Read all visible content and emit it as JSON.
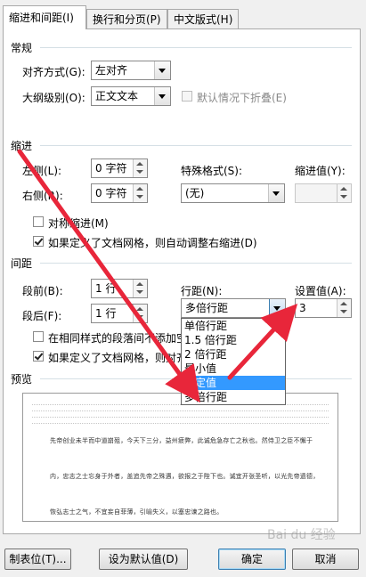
{
  "tabs": [
    {
      "label": "缩进和间距(I)"
    },
    {
      "label": "换行和分页(P)"
    },
    {
      "label": "中文版式(H)"
    }
  ],
  "general": {
    "title": "常规",
    "alignment_label": "对齐方式(G):",
    "alignment_value": "左对齐",
    "outline_label": "大纲级别(O):",
    "outline_value": "正文文本",
    "collapse_label": "默认情况下折叠(E)"
  },
  "indent": {
    "title": "缩进",
    "left_label": "左侧(L):",
    "left_value": "0 字符",
    "right_label": "右侧(R):",
    "right_value": "0 字符",
    "special_label": "特殊格式(S):",
    "special_value": "(无)",
    "indent_by_label": "缩进值(Y):",
    "indent_by_value": "",
    "mirror_label": "对称缩进(M)",
    "grid_adjust_label": "如果定义了文档网格，则自动调整右缩进(D)"
  },
  "spacing": {
    "title": "间距",
    "before_label": "段前(B):",
    "before_value": "1 行",
    "after_label": "段后(F):",
    "after_value": "1 行",
    "line_spacing_label": "行距(N):",
    "line_spacing_value": "多倍行距",
    "set_value_label": "设置值(A):",
    "set_value": "3",
    "no_space_label": "在相同样式的段落间不添加空格",
    "snap_grid_label": "如果定义了文档网格，则对齐到"
  },
  "line_spacing_options": [
    "单倍行距",
    "1.5 倍行距",
    "2 倍行距",
    "最小值",
    "固定值",
    "多倍行距"
  ],
  "line_spacing_selected_index": 4,
  "preview": {
    "title": "预览",
    "lines": [
      "先帝创业未半而中道崩殂，今天下三分，益州疲弊，此诚危急存亡之秋也。然侍卫之臣不懈于",
      "内，忠志之士忘身于外者，盖追先帝之殊遇，欲报之于陛下也。诚宜开张圣听，以光先帝遗德，",
      "恢弘志士之气，不宜妄自菲薄，引喻失义，以塞忠谏之路也。"
    ]
  },
  "buttons": {
    "tabs": "制表位(T)...",
    "set_default": "设为默认值(D)",
    "ok": "确定",
    "cancel": "取消"
  },
  "watermark": "Bai du 经验",
  "colors": {
    "highlight": "#3399ff",
    "annotation_arrow": "#e8263a"
  }
}
